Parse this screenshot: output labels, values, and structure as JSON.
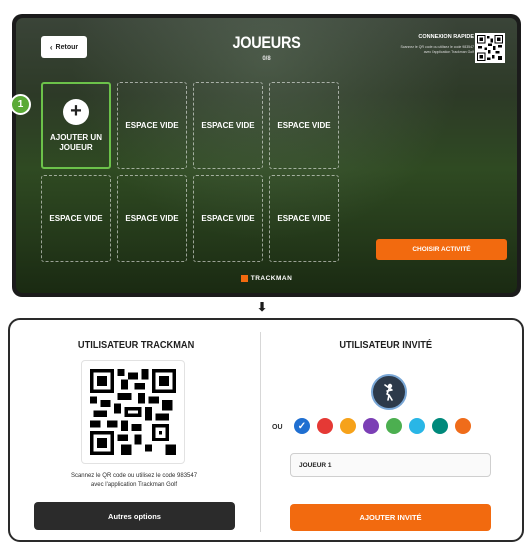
{
  "header": {
    "back_label": "Retour",
    "title": "JOUEURS",
    "count": "0/8",
    "quick_title": "CONNEXION RAPIDE",
    "quick_line1": "Scannez le QR code ou utilisez le code 983547",
    "quick_line2": "avec l'application Trackman Golf"
  },
  "slots": {
    "add_label": "AJOUTER UN JOUEUR",
    "badge": "1",
    "empty_label": "ESPACE VIDE"
  },
  "activity_button": "CHOISIR ACTIVITÉ",
  "brand": "TRACKMAN",
  "arrow": "⬇",
  "trackman_user": {
    "title": "UTILISATEUR TRACKMAN",
    "scan_line1": "Scannez le QR code ou utilisez le code 983547",
    "scan_line2": "avec l'application Trackman Golf",
    "button": "Autres options"
  },
  "guest_user": {
    "title": "UTILISATEUR INVITÉ",
    "or_label": "OU",
    "colors": [
      "#1f6fd1",
      "#e53935",
      "#f6a21a",
      "#7b3fb5",
      "#4caf50",
      "#29b6e6",
      "#00897b",
      "#ef6c1a"
    ],
    "selected_color_index": 0,
    "name_value": "JOUEUR 1",
    "button": "AJOUTER INVITÉ"
  },
  "colors": {
    "accent_orange": "#f26a0f",
    "accent_green": "#6cc24a"
  }
}
